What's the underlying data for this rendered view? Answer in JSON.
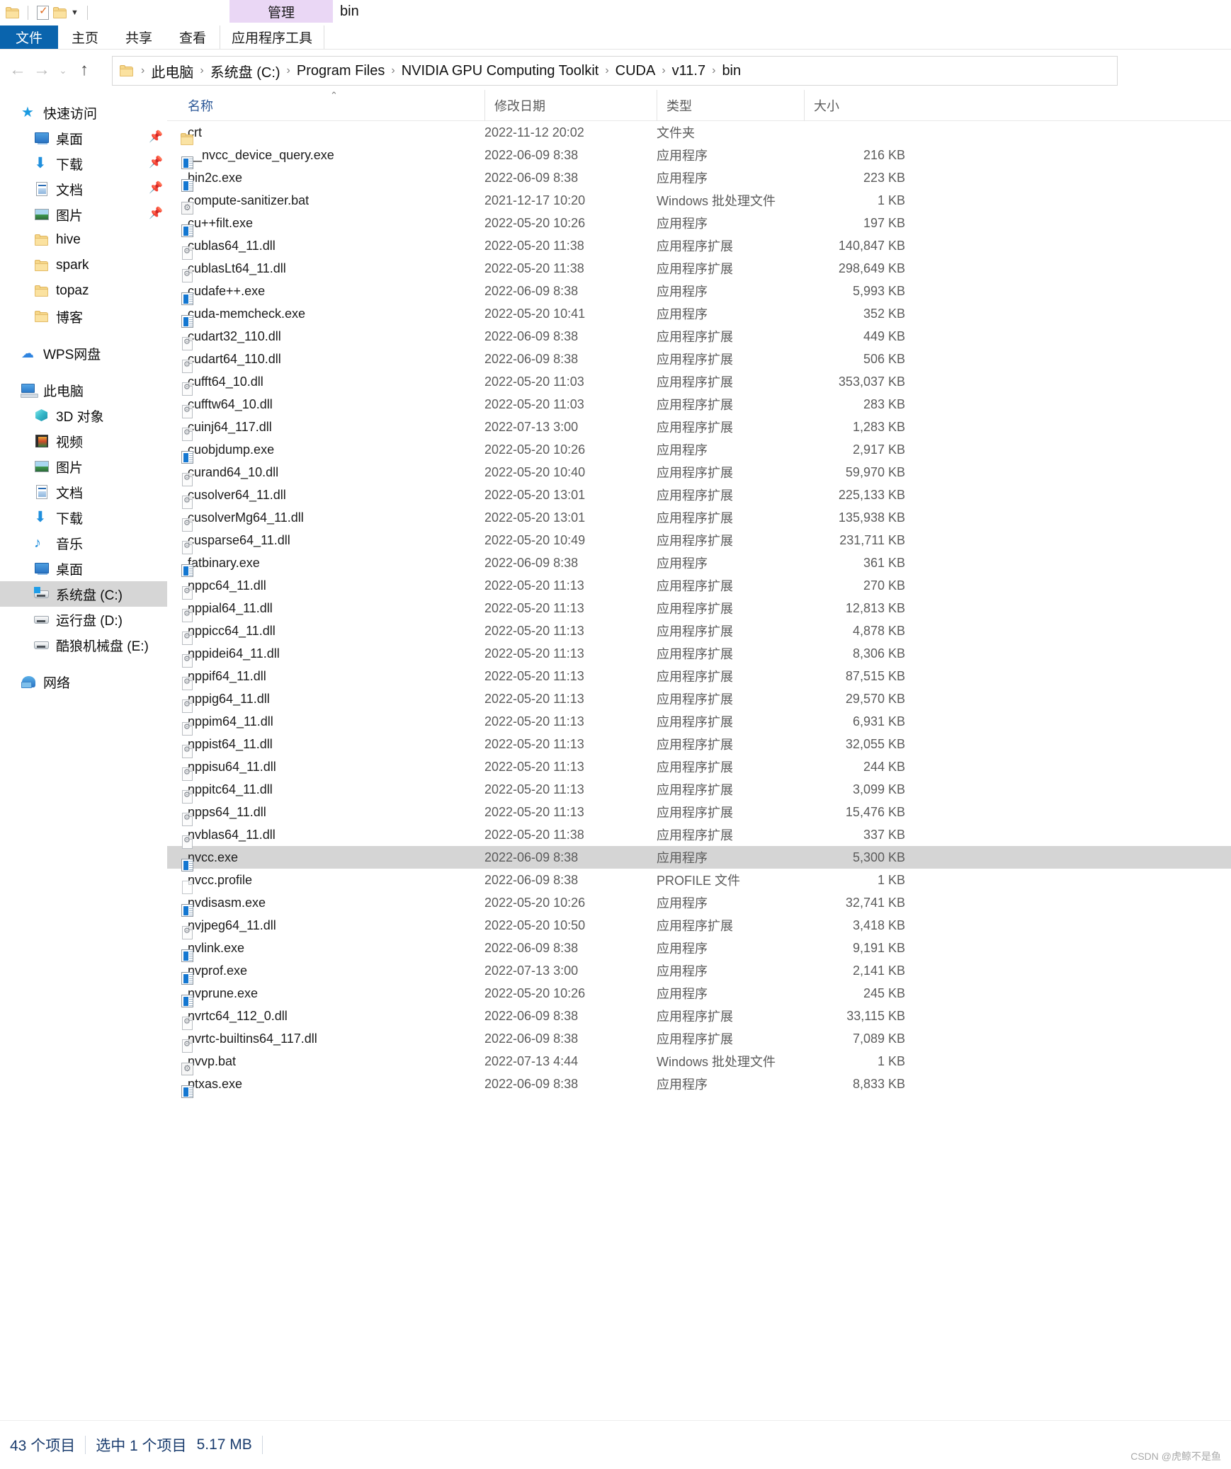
{
  "window": {
    "contextual_tab_group": "管理",
    "title": "bin"
  },
  "quick_access_toolbar": {
    "icons": [
      "folder-icon",
      "properties-icon",
      "new-folder-icon",
      "customize-dropdown-icon"
    ]
  },
  "ribbon": {
    "file_tab": "文件",
    "tabs": [
      "主页",
      "共享",
      "查看"
    ],
    "contextual_tab": "应用程序工具"
  },
  "address_bar": {
    "back": "←",
    "forward": "→",
    "recent": "⌄",
    "up": "↑",
    "breadcrumbs": [
      "此电脑",
      "系统盘 (C:)",
      "Program Files",
      "NVIDIA GPU Computing Toolkit",
      "CUDA",
      "v11.7",
      "bin"
    ],
    "separator": "›"
  },
  "sidebar": {
    "groups": [
      {
        "header": {
          "label": "快速访问",
          "icon": "star-pin-icon"
        },
        "items": [
          {
            "label": "桌面",
            "icon": "desktop-icon",
            "pinned": true
          },
          {
            "label": "下载",
            "icon": "downloads-icon",
            "pinned": true
          },
          {
            "label": "文档",
            "icon": "documents-icon",
            "pinned": true
          },
          {
            "label": "图片",
            "icon": "pictures-icon",
            "pinned": true
          },
          {
            "label": "hive",
            "icon": "folder-icon",
            "pinned": false
          },
          {
            "label": "spark",
            "icon": "folder-icon",
            "pinned": false
          },
          {
            "label": "topaz",
            "icon": "folder-icon",
            "pinned": false
          },
          {
            "label": "博客",
            "icon": "folder-icon",
            "pinned": false
          }
        ]
      },
      {
        "header": {
          "label": "WPS网盘",
          "icon": "cloud-icon"
        },
        "items": []
      },
      {
        "header": {
          "label": "此电脑",
          "icon": "this-pc-icon"
        },
        "items": [
          {
            "label": "3D 对象",
            "icon": "3d-objects-icon",
            "pinned": false
          },
          {
            "label": "视频",
            "icon": "videos-icon",
            "pinned": false
          },
          {
            "label": "图片",
            "icon": "pictures-icon",
            "pinned": false
          },
          {
            "label": "文档",
            "icon": "documents-icon",
            "pinned": false
          },
          {
            "label": "下载",
            "icon": "downloads-icon",
            "pinned": false
          },
          {
            "label": "音乐",
            "icon": "music-icon",
            "pinned": false
          },
          {
            "label": "桌面",
            "icon": "desktop-icon",
            "pinned": false
          },
          {
            "label": "系统盘 (C:)",
            "icon": "windows-drive-icon",
            "selected": true
          },
          {
            "label": "运行盘 (D:)",
            "icon": "drive-icon",
            "pinned": false
          },
          {
            "label": "酷狼机械盘 (E:)",
            "icon": "drive-icon",
            "pinned": false
          }
        ]
      },
      {
        "header": {
          "label": "网络",
          "icon": "network-icon"
        },
        "items": []
      }
    ]
  },
  "file_list": {
    "columns": [
      {
        "key": "name",
        "label": "名称",
        "sorted": "asc"
      },
      {
        "key": "date",
        "label": "修改日期"
      },
      {
        "key": "type",
        "label": "类型"
      },
      {
        "key": "size",
        "label": "大小"
      }
    ],
    "rows": [
      {
        "name": "crt",
        "date": "2022-11-12 20:02",
        "type": "文件夹",
        "size": "",
        "icon": "folder-icon"
      },
      {
        "name": "__nvcc_device_query.exe",
        "date": "2022-06-09 8:38",
        "type": "应用程序",
        "size": "216 KB",
        "icon": "exe-icon"
      },
      {
        "name": "bin2c.exe",
        "date": "2022-06-09 8:38",
        "type": "应用程序",
        "size": "223 KB",
        "icon": "exe-icon"
      },
      {
        "name": "compute-sanitizer.bat",
        "date": "2021-12-17 10:20",
        "type": "Windows 批处理文件",
        "size": "1 KB",
        "icon": "bat-icon"
      },
      {
        "name": "cu++filt.exe",
        "date": "2022-05-20 10:26",
        "type": "应用程序",
        "size": "197 KB",
        "icon": "exe-icon"
      },
      {
        "name": "cublas64_11.dll",
        "date": "2022-05-20 11:38",
        "type": "应用程序扩展",
        "size": "140,847 KB",
        "icon": "dll-icon"
      },
      {
        "name": "cublasLt64_11.dll",
        "date": "2022-05-20 11:38",
        "type": "应用程序扩展",
        "size": "298,649 KB",
        "icon": "dll-icon"
      },
      {
        "name": "cudafe++.exe",
        "date": "2022-06-09 8:38",
        "type": "应用程序",
        "size": "5,993 KB",
        "icon": "exe-icon"
      },
      {
        "name": "cuda-memcheck.exe",
        "date": "2022-05-20 10:41",
        "type": "应用程序",
        "size": "352 KB",
        "icon": "exe-icon"
      },
      {
        "name": "cudart32_110.dll",
        "date": "2022-06-09 8:38",
        "type": "应用程序扩展",
        "size": "449 KB",
        "icon": "dll-icon"
      },
      {
        "name": "cudart64_110.dll",
        "date": "2022-06-09 8:38",
        "type": "应用程序扩展",
        "size": "506 KB",
        "icon": "dll-icon"
      },
      {
        "name": "cufft64_10.dll",
        "date": "2022-05-20 11:03",
        "type": "应用程序扩展",
        "size": "353,037 KB",
        "icon": "dll-icon"
      },
      {
        "name": "cufftw64_10.dll",
        "date": "2022-05-20 11:03",
        "type": "应用程序扩展",
        "size": "283 KB",
        "icon": "dll-icon"
      },
      {
        "name": "cuinj64_117.dll",
        "date": "2022-07-13 3:00",
        "type": "应用程序扩展",
        "size": "1,283 KB",
        "icon": "dll-icon"
      },
      {
        "name": "cuobjdump.exe",
        "date": "2022-05-20 10:26",
        "type": "应用程序",
        "size": "2,917 KB",
        "icon": "exe-icon"
      },
      {
        "name": "curand64_10.dll",
        "date": "2022-05-20 10:40",
        "type": "应用程序扩展",
        "size": "59,970 KB",
        "icon": "dll-icon"
      },
      {
        "name": "cusolver64_11.dll",
        "date": "2022-05-20 13:01",
        "type": "应用程序扩展",
        "size": "225,133 KB",
        "icon": "dll-icon"
      },
      {
        "name": "cusolverMg64_11.dll",
        "date": "2022-05-20 13:01",
        "type": "应用程序扩展",
        "size": "135,938 KB",
        "icon": "dll-icon"
      },
      {
        "name": "cusparse64_11.dll",
        "date": "2022-05-20 10:49",
        "type": "应用程序扩展",
        "size": "231,711 KB",
        "icon": "dll-icon"
      },
      {
        "name": "fatbinary.exe",
        "date": "2022-06-09 8:38",
        "type": "应用程序",
        "size": "361 KB",
        "icon": "exe-icon"
      },
      {
        "name": "nppc64_11.dll",
        "date": "2022-05-20 11:13",
        "type": "应用程序扩展",
        "size": "270 KB",
        "icon": "dll-icon"
      },
      {
        "name": "nppial64_11.dll",
        "date": "2022-05-20 11:13",
        "type": "应用程序扩展",
        "size": "12,813 KB",
        "icon": "dll-icon"
      },
      {
        "name": "nppicc64_11.dll",
        "date": "2022-05-20 11:13",
        "type": "应用程序扩展",
        "size": "4,878 KB",
        "icon": "dll-icon"
      },
      {
        "name": "nppidei64_11.dll",
        "date": "2022-05-20 11:13",
        "type": "应用程序扩展",
        "size": "8,306 KB",
        "icon": "dll-icon"
      },
      {
        "name": "nppif64_11.dll",
        "date": "2022-05-20 11:13",
        "type": "应用程序扩展",
        "size": "87,515 KB",
        "icon": "dll-icon"
      },
      {
        "name": "nppig64_11.dll",
        "date": "2022-05-20 11:13",
        "type": "应用程序扩展",
        "size": "29,570 KB",
        "icon": "dll-icon"
      },
      {
        "name": "nppim64_11.dll",
        "date": "2022-05-20 11:13",
        "type": "应用程序扩展",
        "size": "6,931 KB",
        "icon": "dll-icon"
      },
      {
        "name": "nppist64_11.dll",
        "date": "2022-05-20 11:13",
        "type": "应用程序扩展",
        "size": "32,055 KB",
        "icon": "dll-icon"
      },
      {
        "name": "nppisu64_11.dll",
        "date": "2022-05-20 11:13",
        "type": "应用程序扩展",
        "size": "244 KB",
        "icon": "dll-icon"
      },
      {
        "name": "nppitc64_11.dll",
        "date": "2022-05-20 11:13",
        "type": "应用程序扩展",
        "size": "3,099 KB",
        "icon": "dll-icon"
      },
      {
        "name": "npps64_11.dll",
        "date": "2022-05-20 11:13",
        "type": "应用程序扩展",
        "size": "15,476 KB",
        "icon": "dll-icon"
      },
      {
        "name": "nvblas64_11.dll",
        "date": "2022-05-20 11:38",
        "type": "应用程序扩展",
        "size": "337 KB",
        "icon": "dll-icon"
      },
      {
        "name": "nvcc.exe",
        "date": "2022-06-09 8:38",
        "type": "应用程序",
        "size": "5,300 KB",
        "icon": "exe-icon",
        "selected": true
      },
      {
        "name": "nvcc.profile",
        "date": "2022-06-09 8:38",
        "type": "PROFILE 文件",
        "size": "1 KB",
        "icon": "plain-file-icon"
      },
      {
        "name": "nvdisasm.exe",
        "date": "2022-05-20 10:26",
        "type": "应用程序",
        "size": "32,741 KB",
        "icon": "exe-icon"
      },
      {
        "name": "nvjpeg64_11.dll",
        "date": "2022-05-20 10:50",
        "type": "应用程序扩展",
        "size": "3,418 KB",
        "icon": "dll-icon"
      },
      {
        "name": "nvlink.exe",
        "date": "2022-06-09 8:38",
        "type": "应用程序",
        "size": "9,191 KB",
        "icon": "exe-icon"
      },
      {
        "name": "nvprof.exe",
        "date": "2022-07-13 3:00",
        "type": "应用程序",
        "size": "2,141 KB",
        "icon": "exe-icon"
      },
      {
        "name": "nvprune.exe",
        "date": "2022-05-20 10:26",
        "type": "应用程序",
        "size": "245 KB",
        "icon": "exe-icon"
      },
      {
        "name": "nvrtc64_112_0.dll",
        "date": "2022-06-09 8:38",
        "type": "应用程序扩展",
        "size": "33,115 KB",
        "icon": "dll-icon"
      },
      {
        "name": "nvrtc-builtins64_117.dll",
        "date": "2022-06-09 8:38",
        "type": "应用程序扩展",
        "size": "7,089 KB",
        "icon": "dll-icon"
      },
      {
        "name": "nvvp.bat",
        "date": "2022-07-13 4:44",
        "type": "Windows 批处理文件",
        "size": "1 KB",
        "icon": "bat-icon"
      },
      {
        "name": "ptxas.exe",
        "date": "2022-06-09 8:38",
        "type": "应用程序",
        "size": "8,833 KB",
        "icon": "exe-icon"
      }
    ]
  },
  "status_bar": {
    "item_count": "43 个项目",
    "selection": "选中 1 个项目",
    "selection_size": "5.17 MB",
    "watermark": "CSDN @虎鲸不是鱼"
  },
  "colors": {
    "file_tab_blue": "#0a64ad",
    "contextual_purple": "#ead7f5",
    "header_text_blue": "#2b5797",
    "selection_gray": "#d5d5d5",
    "status_text_blue": "#1a3c6e"
  }
}
